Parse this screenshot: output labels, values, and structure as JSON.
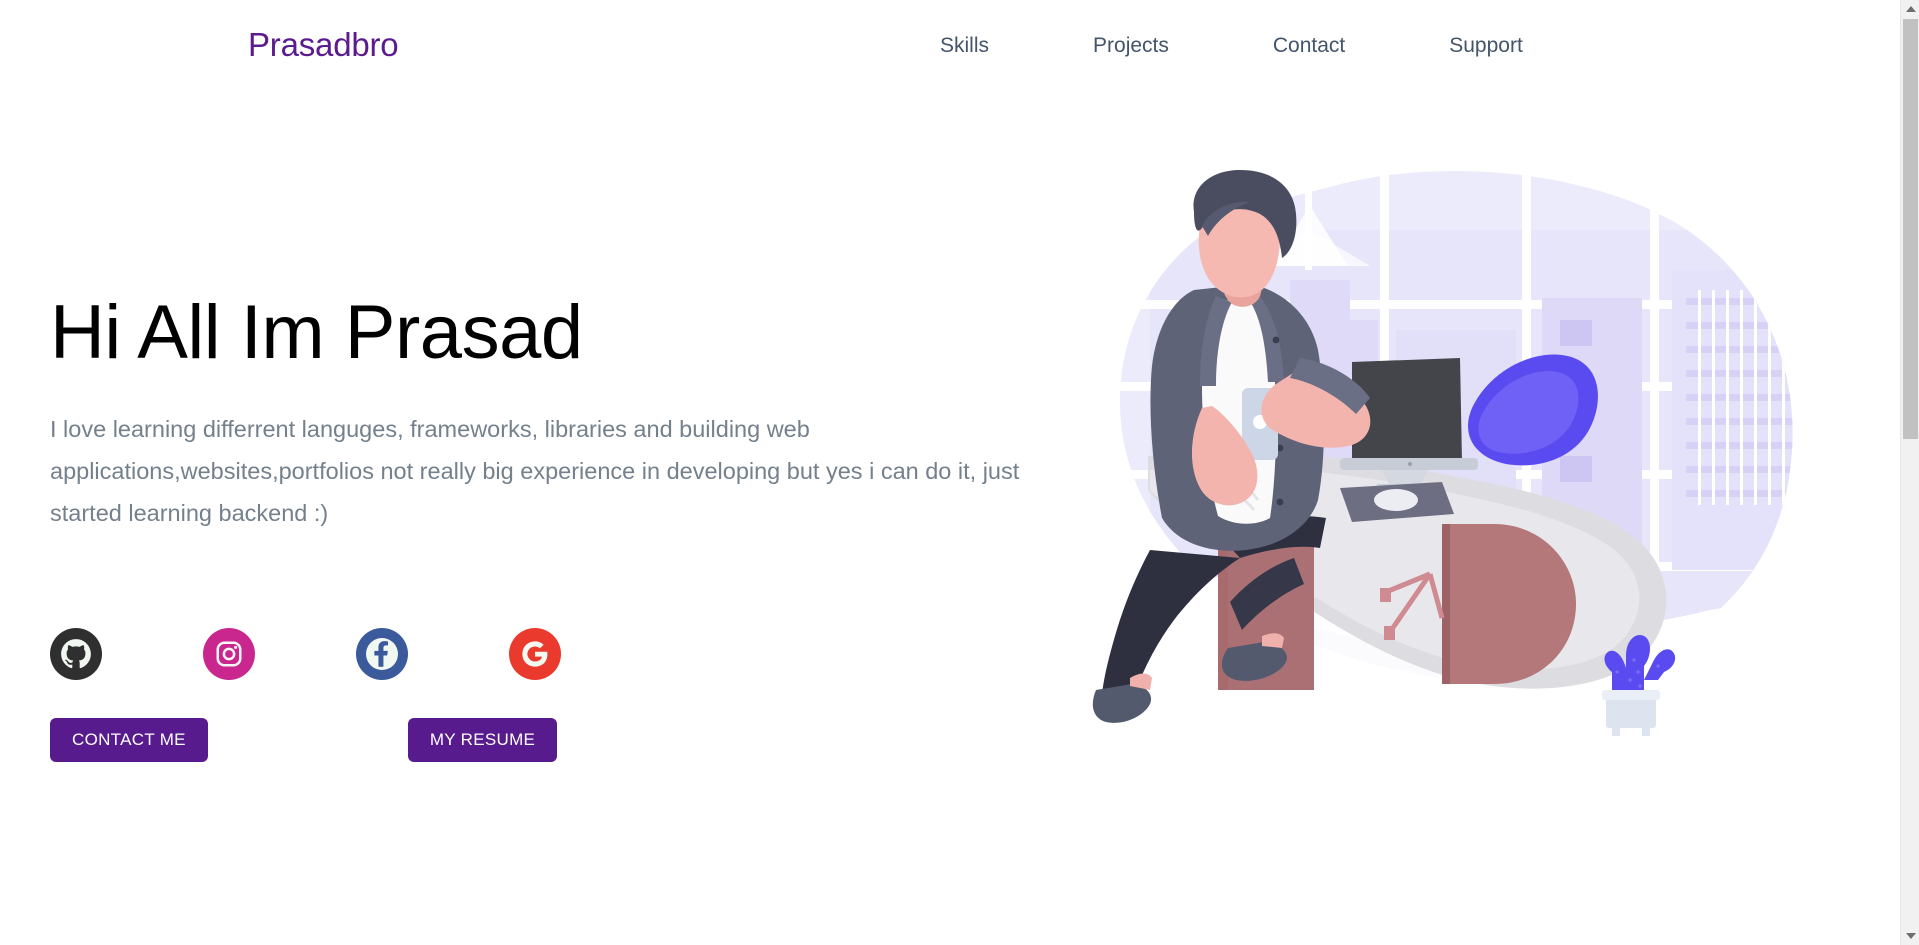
{
  "navbar": {
    "brand": "Prasadbro",
    "links": [
      {
        "label": "Skills",
        "name": "nav-link-skills"
      },
      {
        "label": "Projects",
        "name": "nav-link-projects"
      },
      {
        "label": "Contact",
        "name": "nav-link-contact"
      },
      {
        "label": "Support",
        "name": "nav-link-support"
      }
    ]
  },
  "hero": {
    "title": "Hi All Im Prasad",
    "description": "I love learning differrent languges, frameworks, libraries and building web applications,websites,portfolios not really big experience in developing but yes i can do it, just started learning backend :)",
    "socials": [
      {
        "name": "github-icon",
        "label": "GitHub",
        "color": "#2f2f2f"
      },
      {
        "name": "instagram-icon",
        "label": "Instagram",
        "color": "#c9278e"
      },
      {
        "name": "facebook-icon",
        "label": "Facebook",
        "color": "#3a5a9b"
      },
      {
        "name": "google-icon",
        "label": "Google",
        "color": "#ea3a2d"
      }
    ],
    "buttons": {
      "contact": "CONTACT ME",
      "resume": "MY RESUME"
    },
    "illustration_alt": "Man sitting on desk with monitor, office chair and cactus plant"
  },
  "colors": {
    "brand_purple": "#5b1b8e",
    "button_purple": "#581b8d",
    "nav_text": "#44546b",
    "body_text": "#74808c",
    "heading": "#000000",
    "background": "#ffffff",
    "illustration_lavender": "#e9e7fb",
    "illustration_blue": "#5a4bf0",
    "illustration_mauve": "#a96d6d"
  },
  "scrollbar": {
    "up_arrow": "▲",
    "down_arrow": "▼"
  }
}
